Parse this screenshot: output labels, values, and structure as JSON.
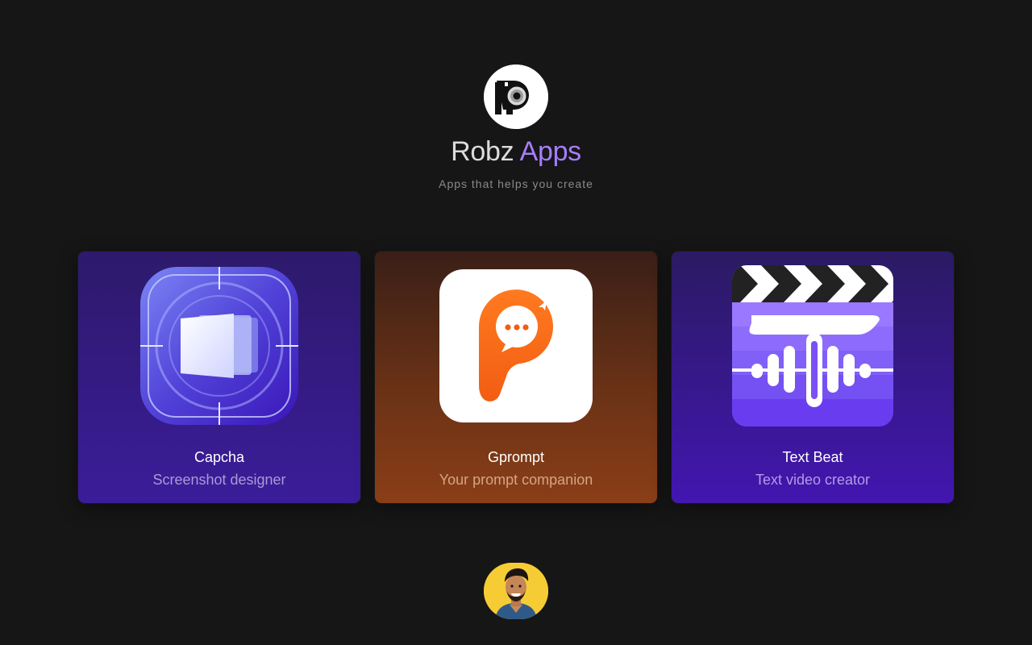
{
  "header": {
    "title_main": "Robz",
    "title_accent": "Apps",
    "subtitle": "Apps that helps you create",
    "logo_icon": "robz-camera-logo-icon"
  },
  "apps": [
    {
      "name": "Capcha",
      "description": "Screenshot designer",
      "icon": "capcha-app-icon",
      "color": "#3b1c9a"
    },
    {
      "name": "Gprompt",
      "description": "Your prompt companion",
      "icon": "gprompt-app-icon",
      "color": "#8a3e17"
    },
    {
      "name": "Text Beat",
      "description": "Text video creator",
      "icon": "text-beat-app-icon",
      "color": "#4216b0"
    }
  ],
  "footer": {
    "avatar_icon": "profile-avatar",
    "avatar_color": "#f6cc35"
  },
  "colors": {
    "background": "#161616",
    "accent": "#a77dff"
  }
}
